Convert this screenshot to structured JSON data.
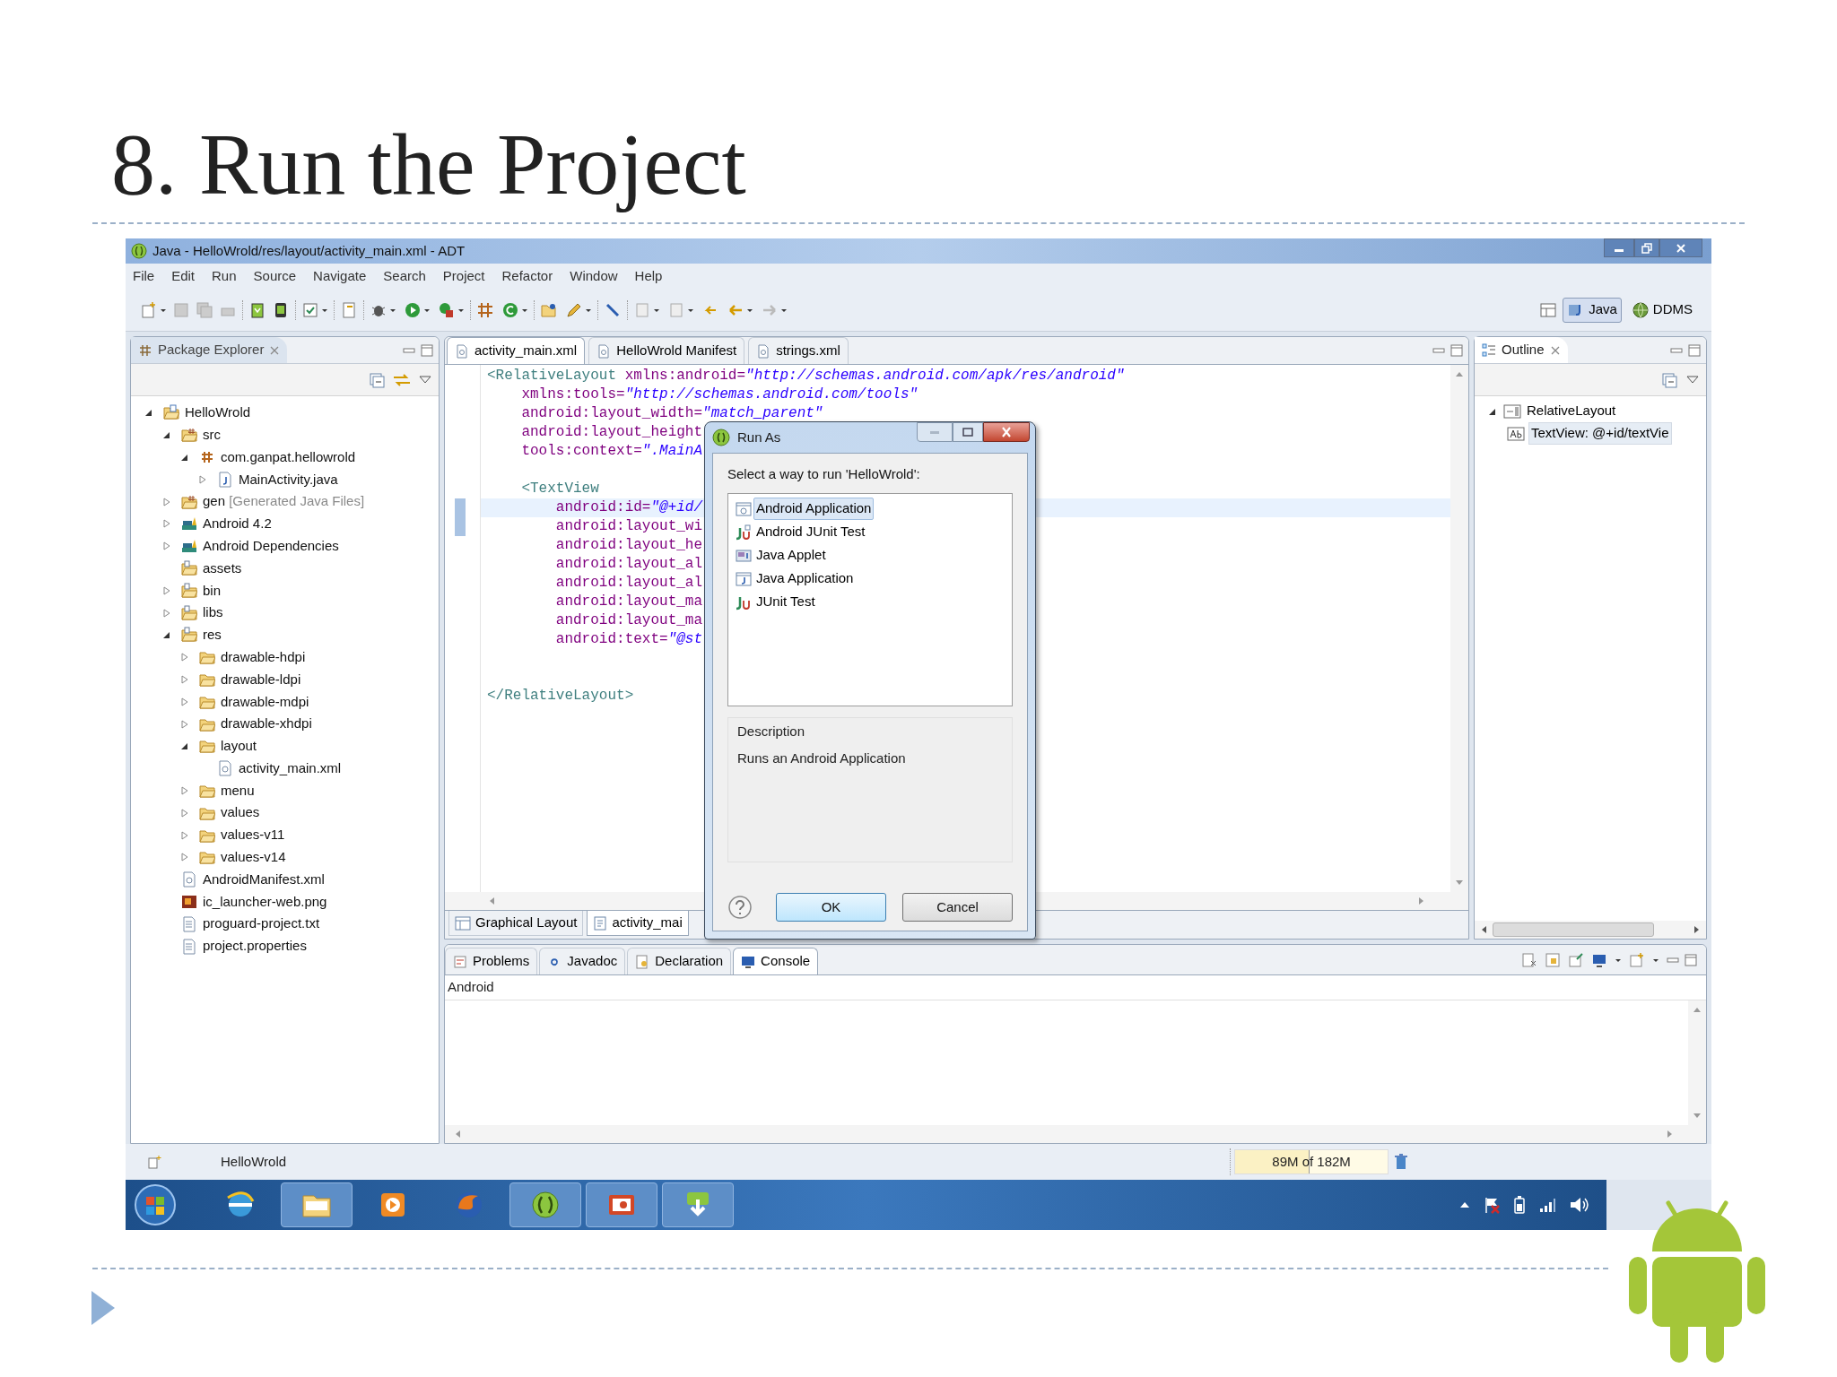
{
  "slide": {
    "title": "8. Run the Project"
  },
  "window": {
    "title": "Java - HelloWrold/res/layout/activity_main.xml - ADT"
  },
  "menu": [
    "File",
    "Edit",
    "Run",
    "Source",
    "Navigate",
    "Search",
    "Project",
    "Refactor",
    "Window",
    "Help"
  ],
  "perspectives": [
    {
      "label": "Java",
      "selected": true
    },
    {
      "label": "DDMS",
      "selected": false
    }
  ],
  "package_explorer": {
    "title": "Package Explorer",
    "tree": [
      {
        "label": "HelloWrold",
        "kind": "project",
        "expanded": true,
        "children": [
          {
            "label": "src",
            "kind": "source-folder",
            "expanded": true,
            "children": [
              {
                "label": "com.ganpat.hellowrold",
                "kind": "package",
                "expanded": true,
                "children": [
                  {
                    "label": "MainActivity.java",
                    "kind": "java-file",
                    "expanded": false
                  }
                ]
              }
            ]
          },
          {
            "label": "gen",
            "note": "[Generated Java Files]",
            "kind": "source-folder",
            "expanded": false
          },
          {
            "label": "Android 4.2",
            "kind": "library",
            "expanded": false
          },
          {
            "label": "Android Dependencies",
            "kind": "library",
            "expanded": false
          },
          {
            "label": "assets",
            "kind": "resource-folder"
          },
          {
            "label": "bin",
            "kind": "resource-folder",
            "expanded": false
          },
          {
            "label": "libs",
            "kind": "resource-folder",
            "expanded": false
          },
          {
            "label": "res",
            "kind": "resource-folder",
            "expanded": true,
            "children": [
              {
                "label": "drawable-hdpi",
                "kind": "folder",
                "expanded": false
              },
              {
                "label": "drawable-ldpi",
                "kind": "folder",
                "expanded": false
              },
              {
                "label": "drawable-mdpi",
                "kind": "folder",
                "expanded": false
              },
              {
                "label": "drawable-xhdpi",
                "kind": "folder",
                "expanded": false
              },
              {
                "label": "layout",
                "kind": "folder",
                "expanded": true,
                "children": [
                  {
                    "label": "activity_main.xml",
                    "kind": "xml-file"
                  }
                ]
              },
              {
                "label": "menu",
                "kind": "folder",
                "expanded": false
              },
              {
                "label": "values",
                "kind": "folder",
                "expanded": false
              },
              {
                "label": "values-v11",
                "kind": "folder",
                "expanded": false
              },
              {
                "label": "values-v14",
                "kind": "folder",
                "expanded": false
              }
            ]
          },
          {
            "label": "AndroidManifest.xml",
            "kind": "xml-file"
          },
          {
            "label": "ic_launcher-web.png",
            "kind": "image-file"
          },
          {
            "label": "proguard-project.txt",
            "kind": "text-file"
          },
          {
            "label": "project.properties",
            "kind": "text-file"
          }
        ]
      }
    ]
  },
  "editor": {
    "tabs": [
      {
        "label": "activity_main.xml",
        "selected": true
      },
      {
        "label": "HelloWrold Manifest",
        "selected": false
      },
      {
        "label": "strings.xml",
        "selected": false
      }
    ],
    "lines": [
      {
        "kind": "code",
        "highlighted": false,
        "tokens": [
          {
            "kind": "tag",
            "text": "<RelativeLayout"
          },
          {
            "kind": "attr",
            "text": " xmlns:android="
          },
          {
            "kind": "value",
            "text": "\"http://schemas.android.com/apk/res/android\""
          }
        ]
      },
      {
        "kind": "code",
        "highlighted": false,
        "tokens": [
          {
            "kind": "attr",
            "text": "    xmlns:tools="
          },
          {
            "kind": "value",
            "text": "\"http://schemas.android.com/tools\""
          }
        ]
      },
      {
        "kind": "code",
        "highlighted": false,
        "tokens": [
          {
            "kind": "attr",
            "text": "    android:layout_width="
          },
          {
            "kind": "value",
            "text": "\"match_parent\""
          }
        ]
      },
      {
        "kind": "code",
        "highlighted": false,
        "tokens": [
          {
            "kind": "attr",
            "text": "    android:layout_height"
          }
        ]
      },
      {
        "kind": "code",
        "highlighted": false,
        "tokens": [
          {
            "kind": "attr",
            "text": "    tools:context="
          },
          {
            "kind": "value",
            "text": "\".MainA"
          }
        ]
      },
      {
        "kind": "blank"
      },
      {
        "kind": "code",
        "highlighted": false,
        "tokens": [
          {
            "kind": "tag",
            "text": "    <TextView"
          }
        ]
      },
      {
        "kind": "code",
        "highlighted": true,
        "tokens": [
          {
            "kind": "attr",
            "text": "        android:id="
          },
          {
            "kind": "value",
            "text": "\"@+id/"
          }
        ]
      },
      {
        "kind": "code",
        "highlighted": false,
        "tokens": [
          {
            "kind": "attr",
            "text": "        android:layout_wi"
          }
        ]
      },
      {
        "kind": "code",
        "highlighted": false,
        "tokens": [
          {
            "kind": "attr",
            "text": "        android:layout_he"
          }
        ]
      },
      {
        "kind": "code",
        "highlighted": false,
        "tokens": [
          {
            "kind": "attr",
            "text": "        android:layout_al"
          }
        ]
      },
      {
        "kind": "code",
        "highlighted": false,
        "tokens": [
          {
            "kind": "attr",
            "text": "        android:layout_al"
          }
        ]
      },
      {
        "kind": "code",
        "highlighted": false,
        "tokens": [
          {
            "kind": "attr",
            "text": "        android:layout_ma"
          }
        ]
      },
      {
        "kind": "code",
        "highlighted": false,
        "tokens": [
          {
            "kind": "attr",
            "text": "        android:layout_ma"
          }
        ]
      },
      {
        "kind": "code",
        "highlighted": false,
        "tokens": [
          {
            "kind": "attr",
            "text": "        android:text="
          },
          {
            "kind": "value",
            "text": "\"@st"
          }
        ]
      },
      {
        "kind": "blank"
      },
      {
        "kind": "blank"
      },
      {
        "kind": "code",
        "highlighted": false,
        "tokens": [
          {
            "kind": "tag",
            "text": "</RelativeLayout>"
          }
        ]
      }
    ],
    "bottom_tabs": [
      {
        "label": "Graphical Layout",
        "selected": false
      },
      {
        "label": "activity_mai",
        "selected": true
      }
    ]
  },
  "outline": {
    "title": "Outline",
    "tree": [
      {
        "label": "RelativeLayout",
        "selected": false,
        "expanded": true,
        "children": [
          {
            "label": "TextView: @+id/textVie",
            "selected": true
          }
        ]
      }
    ]
  },
  "bottom_panel": {
    "tabs": [
      {
        "label": "Problems",
        "selected": false
      },
      {
        "label": "Javadoc",
        "selected": false
      },
      {
        "label": "Declaration",
        "selected": false
      },
      {
        "label": "Console",
        "selected": true
      }
    ],
    "console_label": "Android"
  },
  "status_bar": {
    "selection": "HelloWrold",
    "memory": {
      "reading": "89M of 182M",
      "level": 0.49
    }
  },
  "dialog": {
    "title": "Run As",
    "prompt": "Select a way to run 'HelloWrold':",
    "options": [
      {
        "label": "Android Application",
        "kind": "android-app",
        "selected": true
      },
      {
        "label": "Android JUnit Test",
        "kind": "android-junit",
        "selected": false
      },
      {
        "label": "Java Applet",
        "kind": "applet",
        "selected": false
      },
      {
        "label": "Java Application",
        "kind": "java-app",
        "selected": false
      },
      {
        "label": "JUnit Test",
        "kind": "junit",
        "selected": false
      }
    ],
    "description_label": "Description",
    "description": "Runs an Android Application",
    "buttons": [
      {
        "label": "OK",
        "default": true
      },
      {
        "label": "Cancel",
        "default": false
      }
    ]
  }
}
